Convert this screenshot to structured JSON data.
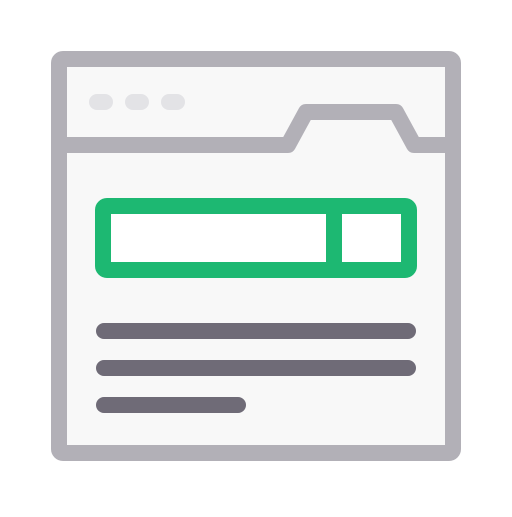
{
  "icon": {
    "name": "browser-window-search-icon",
    "colors": {
      "frame": "#b2b0b7",
      "frame_fill": "#f8f8f8",
      "window_dots": "#e3e3e6",
      "search_box": "#1db872",
      "search_fill": "#ffffff",
      "text_lines": "#6f6b77"
    },
    "elements": {
      "window_dots": [
        "dot-1",
        "dot-2",
        "dot-3"
      ],
      "tab": "browser-tab",
      "search_bar": "search-bar",
      "search_button": "search-button",
      "text_lines": [
        "text-line-1",
        "text-line-2",
        "text-line-3"
      ]
    }
  }
}
